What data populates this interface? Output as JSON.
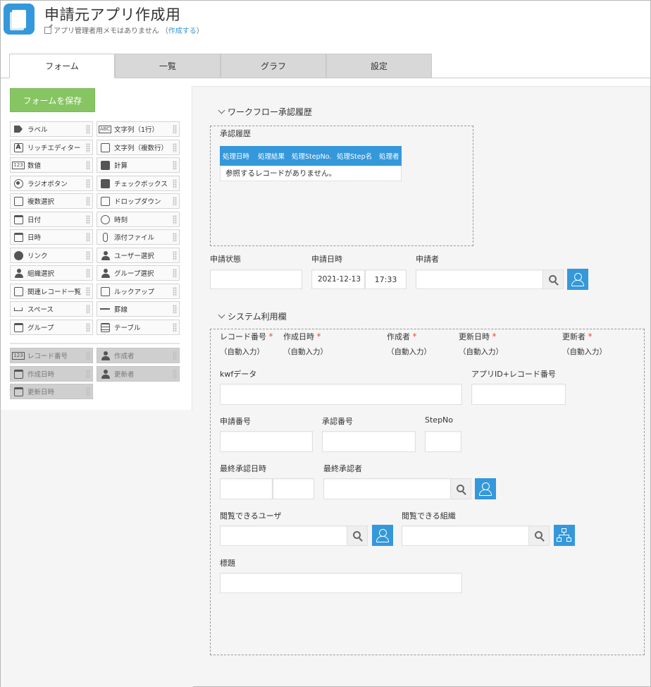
{
  "app": {
    "title": "申請元アプリ作成用",
    "memo_text": "アプリ管理者用メモはありません",
    "memo_link": "作成する"
  },
  "tabs": [
    {
      "label": "フォーム",
      "active": true
    },
    {
      "label": "一覧",
      "active": false
    },
    {
      "label": "グラフ",
      "active": false
    },
    {
      "label": "設定",
      "active": false
    }
  ],
  "palette": {
    "save_label": "フォームを保存",
    "items": [
      {
        "label": "ラベル",
        "icon": "tag-icon"
      },
      {
        "label": "文字列（1行）",
        "icon": "text-single-icon"
      },
      {
        "label": "リッチエディター",
        "icon": "rich-editor-icon"
      },
      {
        "label": "文字列（複数行）",
        "icon": "text-multi-icon"
      },
      {
        "label": "数値",
        "icon": "number-icon"
      },
      {
        "label": "計算",
        "icon": "calculator-icon"
      },
      {
        "label": "ラジオボタン",
        "icon": "radio-icon"
      },
      {
        "label": "チェックボックス",
        "icon": "checkbox-icon"
      },
      {
        "label": "複数選択",
        "icon": "multi-select-icon"
      },
      {
        "label": "ドロップダウン",
        "icon": "dropdown-icon"
      },
      {
        "label": "日付",
        "icon": "date-icon"
      },
      {
        "label": "時刻",
        "icon": "clock-icon"
      },
      {
        "label": "日時",
        "icon": "datetime-icon"
      },
      {
        "label": "添付ファイル",
        "icon": "attachment-icon"
      },
      {
        "label": "リンク",
        "icon": "globe-icon"
      },
      {
        "label": "ユーザー選択",
        "icon": "user-icon"
      },
      {
        "label": "組織選択",
        "icon": "org-icon"
      },
      {
        "label": "グループ選択",
        "icon": "group-icon"
      },
      {
        "label": "関連レコード一覧",
        "icon": "related-records-icon"
      },
      {
        "label": "ルックアップ",
        "icon": "lookup-icon"
      },
      {
        "label": "スペース",
        "icon": "space-icon"
      },
      {
        "label": "罫線",
        "icon": "rule-line-icon"
      },
      {
        "label": "グループ",
        "icon": "group-field-icon"
      },
      {
        "label": "テーブル",
        "icon": "table-icon"
      }
    ],
    "system_items": [
      {
        "label": "レコード番号",
        "icon": "record-number-icon"
      },
      {
        "label": "作成者",
        "icon": "creator-icon"
      },
      {
        "label": "作成日時",
        "icon": "created-date-icon"
      },
      {
        "label": "更新者",
        "icon": "updater-icon"
      },
      {
        "label": "更新日時",
        "icon": "updated-date-icon"
      }
    ]
  },
  "workflow": {
    "section_title": "ワークフロー承認履歴",
    "history_label": "承認履歴",
    "columns": [
      "処理日時",
      "処理結果",
      "処理StepNo.",
      "処理Step名",
      "処理者"
    ],
    "empty_message": "参照するレコードがありません。"
  },
  "status_row": {
    "status_label": "申請状態",
    "date_label": "申請日時",
    "date_value": "2021-12-13",
    "time_value": "17:33",
    "applicant_label": "申請者"
  },
  "system": {
    "section_title": "システム利用欄",
    "required_mark": "*",
    "auto_text": "（自動入力）",
    "auto_fields": [
      "レコード番号",
      "作成日時",
      "作成者",
      "更新日時",
      "更新者"
    ],
    "kwf_label": "kwfデータ",
    "appid_label": "アプリID+レコード番号",
    "apply_no_label": "申請番号",
    "approve_no_label": "承認番号",
    "stepno_label": "StepNo",
    "last_approve_date_label": "最終承認日時",
    "last_approver_label": "最終承認者",
    "viewer_user_label": "閲覧できるユーザ",
    "viewer_org_label": "閲覧できる組織",
    "subject_label": "標題"
  }
}
